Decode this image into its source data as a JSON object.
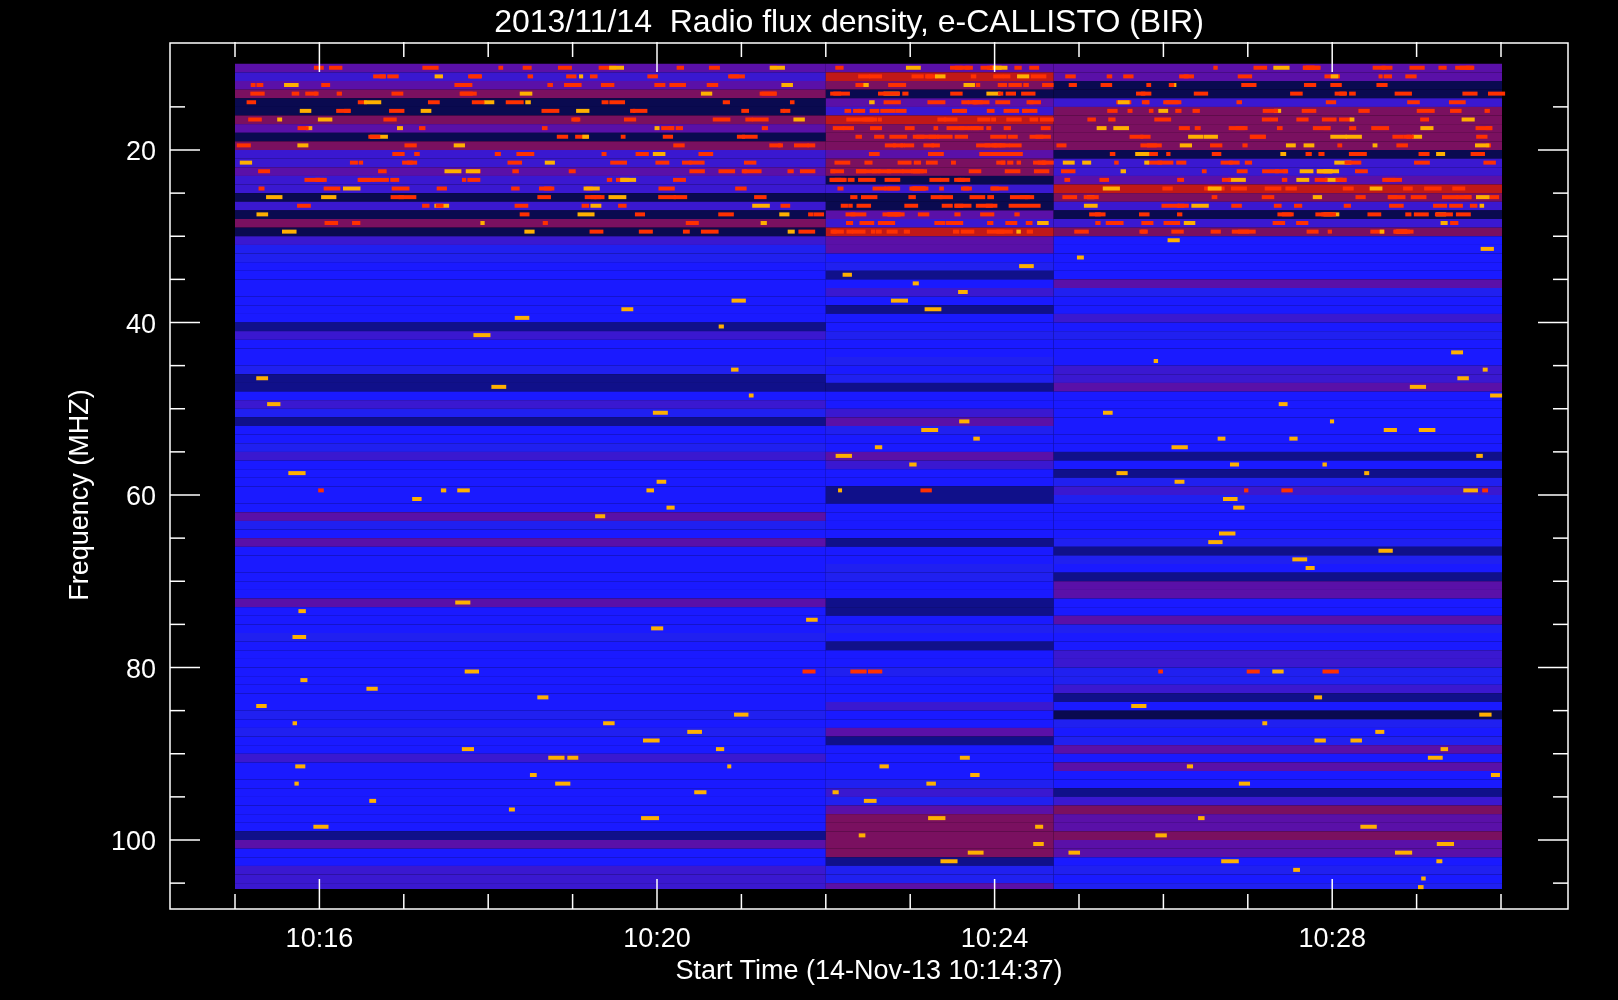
{
  "title": "2013/11/14  Radio flux density, e-CALLISTO (BIR)",
  "y_axis": {
    "label": "Frequency (MHZ)",
    "ticks": [
      "20",
      "40",
      "60",
      "80",
      "100"
    ]
  },
  "x_axis": {
    "label": "Start Time (14-Nov-13 10:14:37)",
    "ticks": [
      "10:16",
      "10:20",
      "10:24",
      "10:28"
    ]
  }
}
